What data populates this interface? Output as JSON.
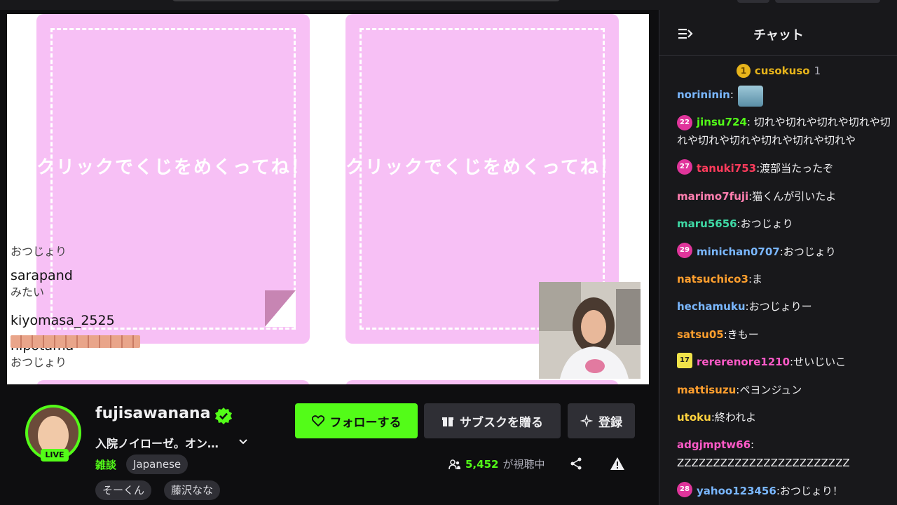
{
  "video": {
    "card_line1": "クリックで",
    "card_line2": "くじをめくってね！",
    "overlay_chat": [
      {
        "text": "おつじょり",
        "kind": "line"
      },
      {
        "text": "sarapand",
        "kind": "uname"
      },
      {
        "text": "みたい",
        "kind": "line"
      },
      {
        "text": "kiyomasa_2525",
        "kind": "uname"
      },
      {
        "text": "hipotama",
        "kind": "uname"
      },
      {
        "text": "おつじょり",
        "kind": "line"
      }
    ]
  },
  "channel": {
    "name": "fujisawanana",
    "live_label": "LIVE",
    "title": "入院ノイローゼ。オン…",
    "category": "雑談",
    "tags": [
      "Japanese",
      "そーくん",
      "藤沢なな"
    ],
    "follow_label": "フォローする",
    "gift_label": "サブスクを贈る",
    "subscribe_label": "登録",
    "viewer_count": "5,452",
    "viewer_label": "が視聴中"
  },
  "chat": {
    "title": "チャット",
    "pinned": {
      "rank": "1",
      "name": "cusokuso",
      "count": "1"
    },
    "messages": [
      {
        "user": "norininin",
        "color": "#7ab7ff",
        "sep": ":",
        "text": "",
        "badge": "",
        "emote": true
      },
      {
        "user": "jinsu724",
        "color": "#53fc18",
        "sep": ":",
        "text": " 切れや切れや切れや切れや切れや切れや切れや切れや切れや切れや",
        "badge": "22",
        "badge_type": "pink",
        "wrap": true
      },
      {
        "user": "tanuki753",
        "color": "#ff3b5c",
        "sep": ":",
        "text": " 渡部当たったぞ",
        "badge": "27",
        "badge_type": "pink"
      },
      {
        "user": "marimo7fuji",
        "color": "#ff7fb0",
        "sep": ":",
        "text": " 猫くんが引いたよ",
        "badge": ""
      },
      {
        "user": "maru5656",
        "color": "#3fd9a5",
        "sep": ":",
        "text": " おつじょり",
        "badge": ""
      },
      {
        "user": "minichan0707",
        "color": "#7ab7ff",
        "sep": ":",
        "text": " おつじょり",
        "badge": "29",
        "badge_type": "pink"
      },
      {
        "user": "natsuchico3",
        "color": "#ff9f2e",
        "sep": ":",
        "text": " ま",
        "badge": ""
      },
      {
        "user": "hechamuku",
        "color": "#7ab7ff",
        "sep": ":",
        "text": " おつじょりー",
        "badge": ""
      },
      {
        "user": "satsu05",
        "color": "#ff9f2e",
        "sep": ":",
        "text": " きもー",
        "badge": ""
      },
      {
        "user": "rererenore1210",
        "color": "#ff5ac8",
        "sep": ":",
        "text": " せいじいこ",
        "badge": "17",
        "badge_type": "yellow"
      },
      {
        "user": "mattisuzu",
        "color": "#ff9f2e",
        "sep": ":",
        "text": " ペヨンジュン",
        "badge": ""
      },
      {
        "user": "utoku",
        "color": "#ffd23e",
        "sep": ":",
        "text": " 終われよ",
        "badge": ""
      },
      {
        "user": "adgjmptw66",
        "color": "#ff5ac8",
        "sep": ":",
        "text": " ZZZZZZZZZZZZZZZZZZZZZZZZ",
        "badge": "",
        "wrap": true
      },
      {
        "user": "yahoo123456",
        "color": "#7ab7ff",
        "sep": ":",
        "text": " おつじょり！",
        "badge": "28",
        "badge_type": "pink"
      }
    ]
  },
  "colors": {
    "accent": "#53fc18",
    "bg": "#0e0e10",
    "panel": "#18181b",
    "card_pink": "#f7c0f5"
  }
}
